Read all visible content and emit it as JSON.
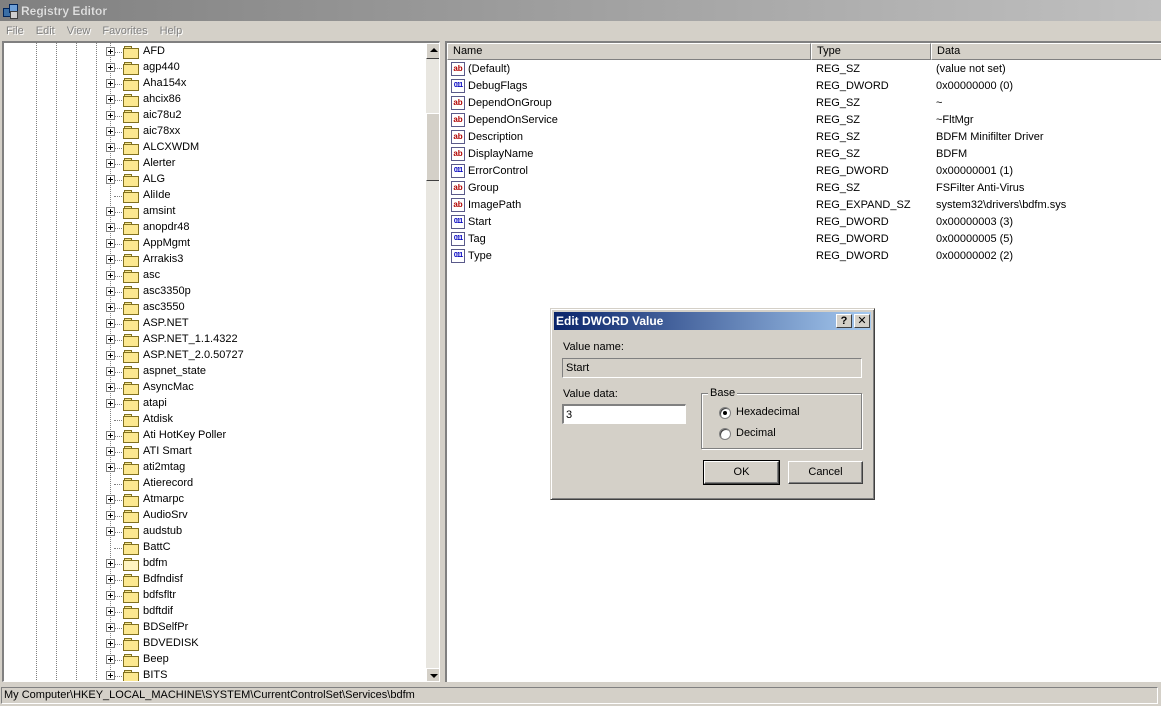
{
  "window": {
    "title": "Registry Editor",
    "icon": "registry-editor-icon"
  },
  "menu": [
    "File",
    "Edit",
    "View",
    "Favorites",
    "Help"
  ],
  "tree": {
    "items": [
      {
        "label": "AFD",
        "expandable": true
      },
      {
        "label": "agp440",
        "expandable": true
      },
      {
        "label": "Aha154x",
        "expandable": true
      },
      {
        "label": "ahcix86",
        "expandable": true
      },
      {
        "label": "aic78u2",
        "expandable": true
      },
      {
        "label": "aic78xx",
        "expandable": true
      },
      {
        "label": "ALCXWDM",
        "expandable": true
      },
      {
        "label": "Alerter",
        "expandable": true
      },
      {
        "label": "ALG",
        "expandable": true
      },
      {
        "label": "AliIde",
        "expandable": false
      },
      {
        "label": "amsint",
        "expandable": true
      },
      {
        "label": "anopdr48",
        "expandable": true
      },
      {
        "label": "AppMgmt",
        "expandable": true
      },
      {
        "label": "Arrakis3",
        "expandable": true
      },
      {
        "label": "asc",
        "expandable": true
      },
      {
        "label": "asc3350p",
        "expandable": true
      },
      {
        "label": "asc3550",
        "expandable": true
      },
      {
        "label": "ASP.NET",
        "expandable": true
      },
      {
        "label": "ASP.NET_1.1.4322",
        "expandable": true
      },
      {
        "label": "ASP.NET_2.0.50727",
        "expandable": true
      },
      {
        "label": "aspnet_state",
        "expandable": true
      },
      {
        "label": "AsyncMac",
        "expandable": true
      },
      {
        "label": "atapi",
        "expandable": true
      },
      {
        "label": "Atdisk",
        "expandable": false
      },
      {
        "label": "Ati HotKey Poller",
        "expandable": true
      },
      {
        "label": "ATI Smart",
        "expandable": true
      },
      {
        "label": "ati2mtag",
        "expandable": true
      },
      {
        "label": "Atierecord",
        "expandable": false
      },
      {
        "label": "Atmarpc",
        "expandable": true
      },
      {
        "label": "AudioSrv",
        "expandable": true
      },
      {
        "label": "audstub",
        "expandable": true
      },
      {
        "label": "BattC",
        "expandable": false
      },
      {
        "label": "bdfm",
        "expandable": true,
        "selected": true
      },
      {
        "label": "Bdfndisf",
        "expandable": true
      },
      {
        "label": "bdfsfltr",
        "expandable": true
      },
      {
        "label": "bdftdif",
        "expandable": true
      },
      {
        "label": "BDSelfPr",
        "expandable": true
      },
      {
        "label": "BDVEDISK",
        "expandable": true
      },
      {
        "label": "Beep",
        "expandable": true
      },
      {
        "label": "BITS",
        "expandable": true
      }
    ]
  },
  "list": {
    "headers": {
      "name": "Name",
      "type": "Type",
      "data": "Data"
    },
    "rows": [
      {
        "name": "(Default)",
        "type": "REG_SZ",
        "data": "(value not set)",
        "kind": "sz"
      },
      {
        "name": "DebugFlags",
        "type": "REG_DWORD",
        "data": "0x00000000 (0)",
        "kind": "dw"
      },
      {
        "name": "DependOnGroup",
        "type": "REG_SZ",
        "data": "~",
        "kind": "sz"
      },
      {
        "name": "DependOnService",
        "type": "REG_SZ",
        "data": "~FltMgr",
        "kind": "sz"
      },
      {
        "name": "Description",
        "type": "REG_SZ",
        "data": "BDFM Minifilter Driver",
        "kind": "sz"
      },
      {
        "name": "DisplayName",
        "type": "REG_SZ",
        "data": "BDFM",
        "kind": "sz"
      },
      {
        "name": "ErrorControl",
        "type": "REG_DWORD",
        "data": "0x00000001 (1)",
        "kind": "dw"
      },
      {
        "name": "Group",
        "type": "REG_SZ",
        "data": "FSFilter Anti-Virus",
        "kind": "sz"
      },
      {
        "name": "ImagePath",
        "type": "REG_EXPAND_SZ",
        "data": "system32\\drivers\\bdfm.sys",
        "kind": "sz"
      },
      {
        "name": "Start",
        "type": "REG_DWORD",
        "data": "0x00000003 (3)",
        "kind": "dw"
      },
      {
        "name": "Tag",
        "type": "REG_DWORD",
        "data": "0x00000005 (5)",
        "kind": "dw"
      },
      {
        "name": "Type",
        "type": "REG_DWORD",
        "data": "0x00000002 (2)",
        "kind": "dw"
      }
    ]
  },
  "status": "My Computer\\HKEY_LOCAL_MACHINE\\SYSTEM\\CurrentControlSet\\Services\\bdfm",
  "dialog": {
    "title": "Edit DWORD Value",
    "help_glyph": "?",
    "close_glyph": "✕",
    "value_name_label": "Value name:",
    "value_name": "Start",
    "value_data_label": "Value data:",
    "value_data": "3",
    "base_label": "Base",
    "hex_label": "Hexadecimal",
    "dec_label": "Decimal",
    "selected_base": "hex",
    "ok_label": "OK",
    "cancel_label": "Cancel"
  },
  "icons": {
    "sz_glyph": "ab",
    "dw_glyph": "011"
  }
}
